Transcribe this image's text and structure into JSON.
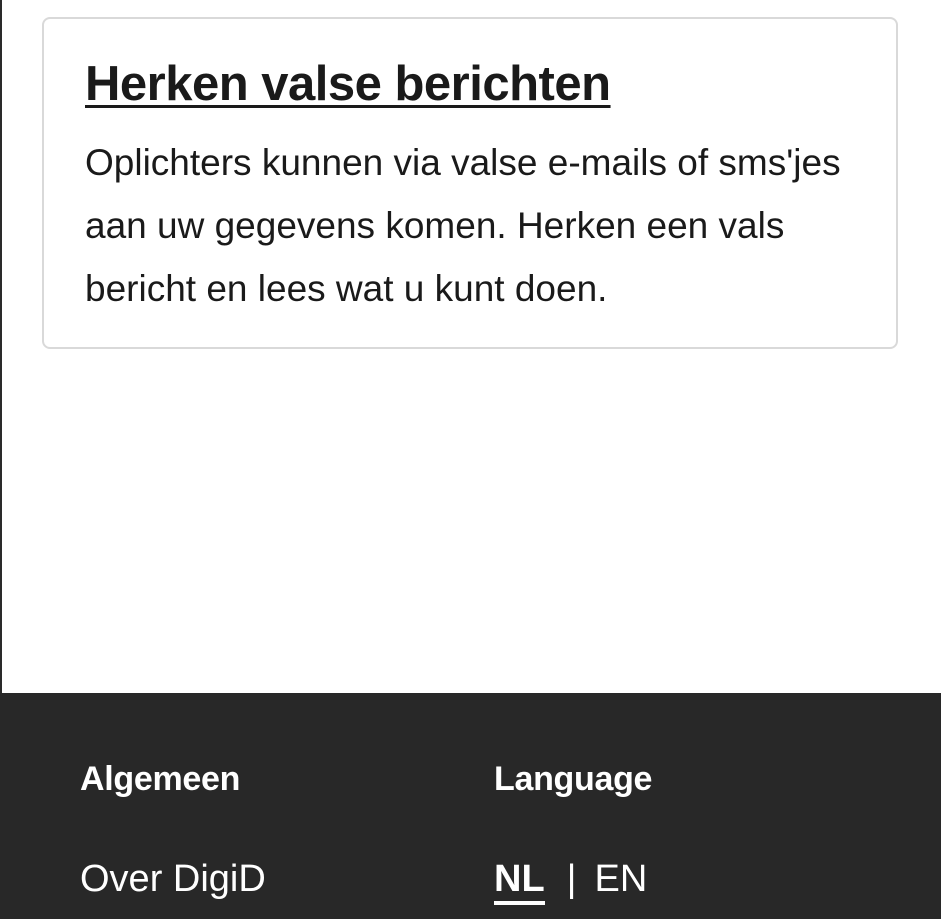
{
  "card": {
    "title": "Herken valse berichten",
    "body": "Oplichters kunnen via valse e-mails of sms'jes aan uw gegevens komen. Herken een vals bericht en lees wat u kunt doen."
  },
  "footer": {
    "general": {
      "heading": "Algemeen",
      "links": [
        "Over DigiD"
      ]
    },
    "language": {
      "heading": "Language",
      "active": "NL",
      "separator": "|",
      "other": "EN"
    }
  },
  "colors": {
    "footer_background": "#282828",
    "card_border": "#d9d9d9",
    "text": "#1a1a1a"
  }
}
